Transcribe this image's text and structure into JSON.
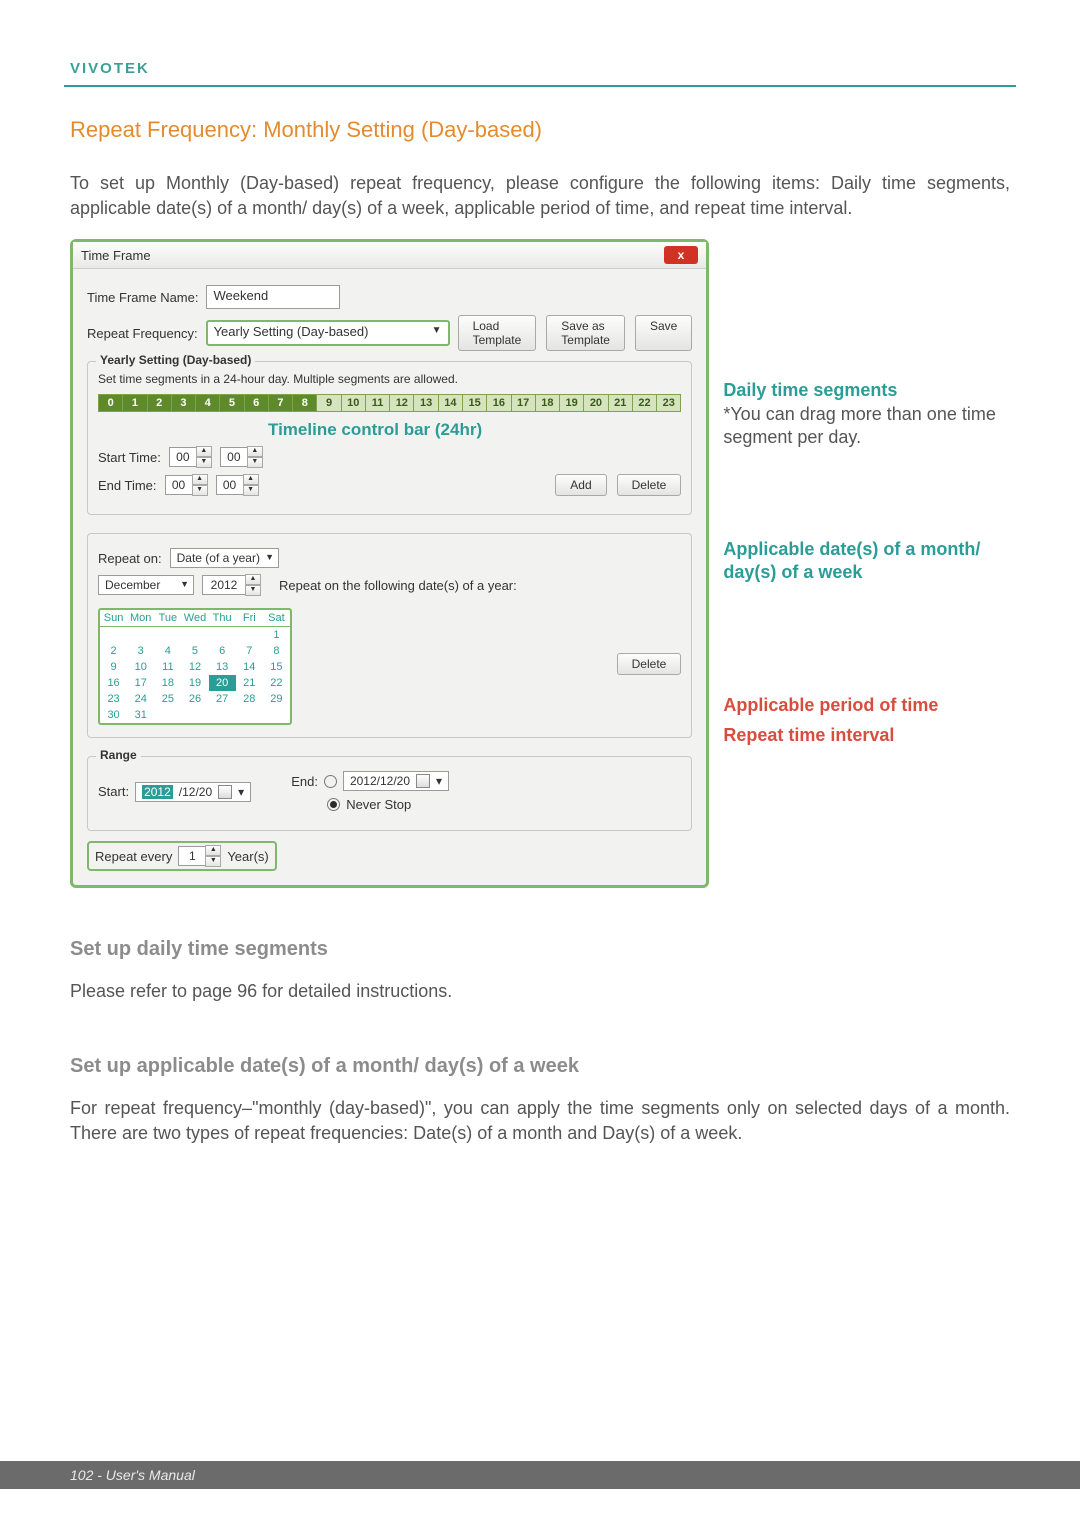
{
  "brand": "VIVOTEK",
  "heading_orange": "Repeat Frequency: Monthly Setting (Day-based)",
  "intro": "To set up Monthly (Day-based) repeat frequency, please configure the following items: Daily time segments, applicable date(s) of a month/ day(s) of a week, applicable period of time, and repeat time interval.",
  "dialog": {
    "title": "Time Frame",
    "close": "x",
    "tf_name_label": "Time Frame Name:",
    "tf_name_value": "Weekend",
    "rf_label": "Repeat Frequency:",
    "rf_value": "Yearly Setting (Day-based)",
    "btn_load": "Load Template",
    "btn_saveas": "Save as Template",
    "btn_save": "Save",
    "yearly_legend": "Yearly Setting (Day-based)",
    "yearly_hint": "Set time segments in a 24-hour day. Multiple segments are allowed.",
    "hours": [
      "0",
      "1",
      "2",
      "3",
      "4",
      "5",
      "6",
      "7",
      "8",
      "9",
      "10",
      "11",
      "12",
      "13",
      "14",
      "15",
      "16",
      "17",
      "18",
      "19",
      "20",
      "21",
      "22",
      "23"
    ],
    "timeline_caption": "Timeline control bar (24hr)",
    "start_time_label": "Start Time:",
    "end_time_label": "End Time:",
    "start_h": "00",
    "start_m": "00",
    "end_h": "00",
    "end_m": "00",
    "btn_add": "Add",
    "btn_delete": "Delete",
    "repeat_on_label": "Repeat on:",
    "repeat_on_value": "Date (of a year)",
    "month_value": "December",
    "year_value": "2012",
    "repeat_on_hint": "Repeat on the following date(s) of a year:",
    "cal_head": [
      "Sun",
      "Mon",
      "Tue",
      "Wed",
      "Thu",
      "Fri",
      "Sat"
    ],
    "cal_rows": [
      [
        "",
        "",
        "",
        "",
        "",
        "",
        "1"
      ],
      [
        "2",
        "3",
        "4",
        "5",
        "6",
        "7",
        "8"
      ],
      [
        "9",
        "10",
        "11",
        "12",
        "13",
        "14",
        "15"
      ],
      [
        "16",
        "17",
        "18",
        "19",
        "20",
        "21",
        "22"
      ],
      [
        "23",
        "24",
        "25",
        "26",
        "27",
        "28",
        "29"
      ],
      [
        "30",
        "31",
        "",
        "",
        "",
        "",
        ""
      ]
    ],
    "cal_selected": "20",
    "btn_delete2": "Delete",
    "range_legend": "Range",
    "range_start_label": "Start:",
    "range_start_value_year": "2012",
    "range_start_value_rest": "/12/20",
    "range_end_label": "End:",
    "range_end_value": "2012/12/20",
    "range_never": "Never Stop",
    "repeat_every_label": "Repeat every",
    "repeat_every_value": "1",
    "repeat_every_unit": "Year(s)"
  },
  "callouts": {
    "daily_title": "Daily time segments",
    "daily_note": "*You can drag more than one time segment per day.",
    "applicable_dates": "Applicable date(s) of a month/ day(s) of a week",
    "period": "Applicable period of time",
    "interval": "Repeat time interval"
  },
  "h_gray1": "Set up daily time segments",
  "p_gray1": "Please refer to page 96 for detailed instructions.",
  "h_gray2": "Set up applicable date(s) of a month/ day(s) of a week",
  "p_gray2": "For repeat frequency–\"monthly (day-based)\", you can apply the time segments only on selected days of a month. There are two types of repeat frequencies: Date(s) of a month and Day(s) of a week.",
  "footer": "102 - User's Manual"
}
